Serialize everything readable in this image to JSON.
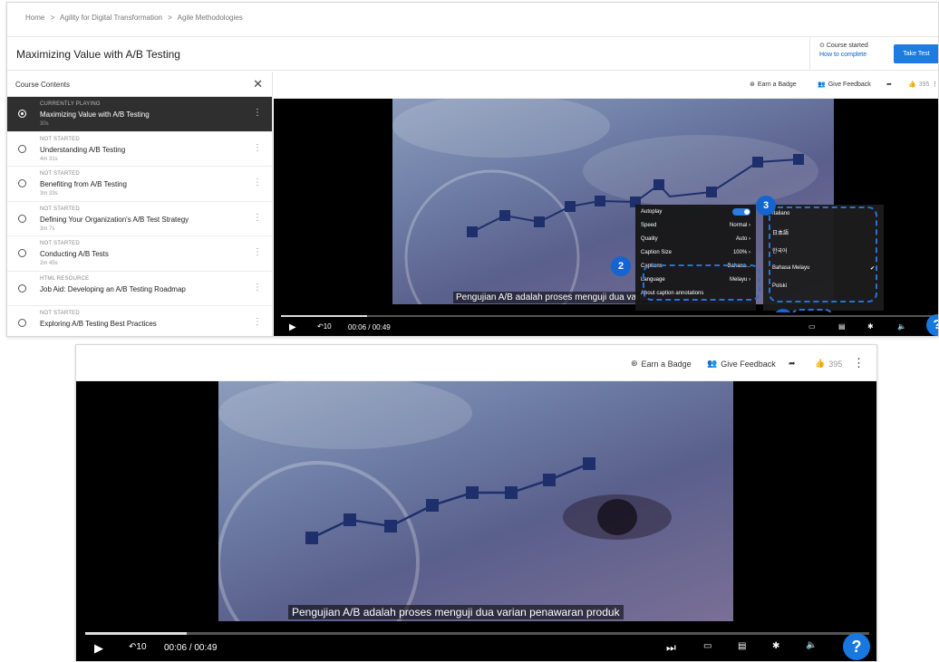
{
  "breadcrumb": [
    "Home",
    ">",
    "Agility for Digital Transformation",
    ">",
    "Agile Methodologies"
  ],
  "course_title": "Maximizing Value with A/B Testing",
  "status": {
    "label": "Course started",
    "link": "How to complete"
  },
  "take_test": "Take Test",
  "sidebar": {
    "title": "Course Contents",
    "items": [
      {
        "status": "CURRENTLY PLAYING",
        "name": "Maximizing Value with A/B Testing",
        "duration": "30s"
      },
      {
        "status": "NOT STARTED",
        "name": "Understanding A/B Testing",
        "duration": "4m 31s"
      },
      {
        "status": "NOT STARTED",
        "name": "Benefiting from A/B Testing",
        "duration": "3m 33s"
      },
      {
        "status": "NOT STARTED",
        "name": "Defining Your Organization's A/B Test Strategy",
        "duration": "3m 7s"
      },
      {
        "status": "NOT STARTED",
        "name": "Conducting A/B Tests",
        "duration": "2m 45s"
      },
      {
        "status": "HTML RESOURCE",
        "name": "Job Aid: Developing an A/B Testing Roadmap",
        "duration": ""
      },
      {
        "status": "NOT STARTED",
        "name": "Exploring A/B Testing Best Practices",
        "duration": ""
      }
    ]
  },
  "toolbar": {
    "earn_badge": "Earn a Badge",
    "give_feedback": "Give Feedback",
    "likes": "395"
  },
  "player": {
    "subtitle_top": "Pengujian A/B adalah proses menguji dua varia",
    "subtitle_full": "Pengujian A/B adalah proses menguji dua varian penawaran produk",
    "time_current": "00:06",
    "time_sep": "/",
    "time_total": "00:49",
    "progress": 0.13
  },
  "settings_menu": [
    {
      "label": "Autoplay",
      "value": ""
    },
    {
      "label": "Speed",
      "value": "Normal"
    },
    {
      "label": "Quality",
      "value": "Auto"
    },
    {
      "label": "Caption Size",
      "value": "100%"
    },
    {
      "label": "Captions",
      "value": "Bahasa..."
    },
    {
      "label": "Language",
      "value": "Melayu"
    },
    {
      "label": "About caption annotations",
      "value": ""
    }
  ],
  "language_menu": [
    {
      "label": "Italiano",
      "checked": false
    },
    {
      "label": "日本語",
      "checked": false
    },
    {
      "label": "한국어",
      "checked": false
    },
    {
      "label": "Bahasa Melayu",
      "checked": true
    },
    {
      "label": "Polski",
      "checked": false
    }
  ],
  "callouts": [
    "1",
    "2",
    "3"
  ],
  "help": "?"
}
